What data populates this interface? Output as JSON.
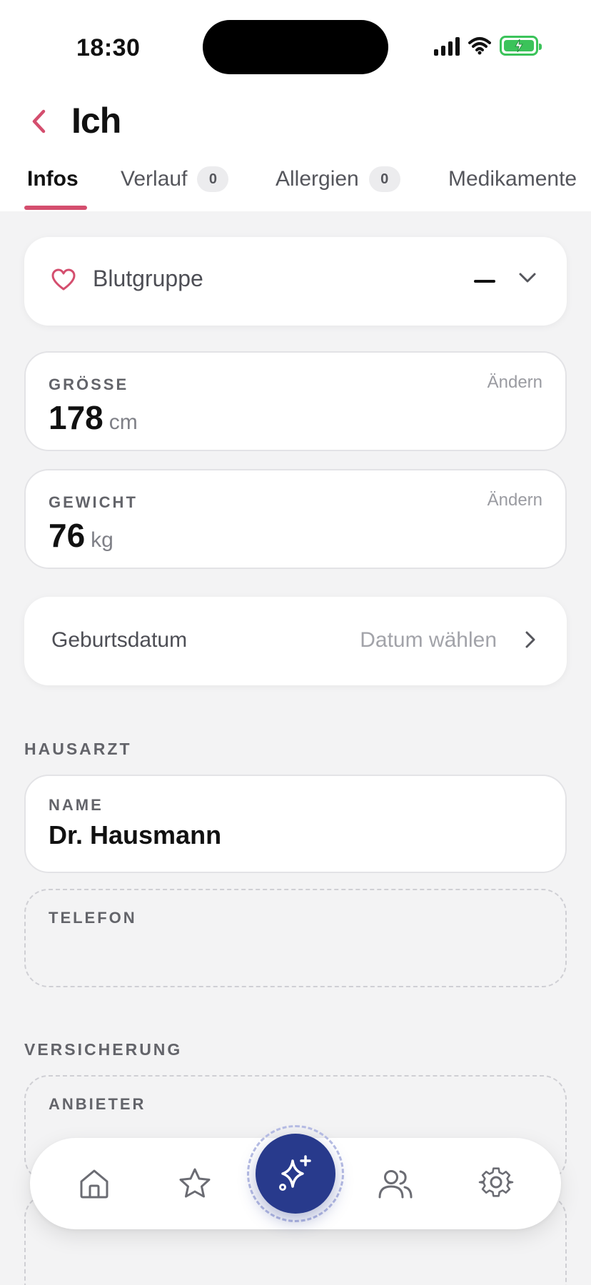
{
  "status_bar": {
    "time": "18:30"
  },
  "header": {
    "title": "Ich"
  },
  "tabs": [
    {
      "label": "Infos",
      "active": true
    },
    {
      "label": "Verlauf",
      "badge": "0"
    },
    {
      "label": "Allergien",
      "badge": "0"
    },
    {
      "label": "Medikamente"
    }
  ],
  "blood_group": {
    "label": "Blutgruppe",
    "value": "—",
    "icon": "heart-icon"
  },
  "height": {
    "label": "GRÖSSE",
    "value": "178",
    "unit": "cm",
    "edit": "Ändern"
  },
  "weight": {
    "label": "GEWICHT",
    "value": "76",
    "unit": "kg",
    "edit": "Ändern"
  },
  "birthdate": {
    "label": "Geburtsdatum",
    "placeholder": "Datum wählen"
  },
  "family_doctor": {
    "section": "HAUSARZT",
    "name_label": "NAME",
    "name": "Dr. Hausmann",
    "phone_label": "TELEFON"
  },
  "insurance": {
    "section": "VERSICHERUNG",
    "provider_label": "ANBIETER"
  },
  "bottom_nav": [
    "home-icon",
    "star-icon",
    "sparkles-icon",
    "people-icon",
    "gear-icon"
  ],
  "colors": {
    "accent": "#d44e6e",
    "fab": "#283a8c",
    "background": "#f3f3f4"
  }
}
